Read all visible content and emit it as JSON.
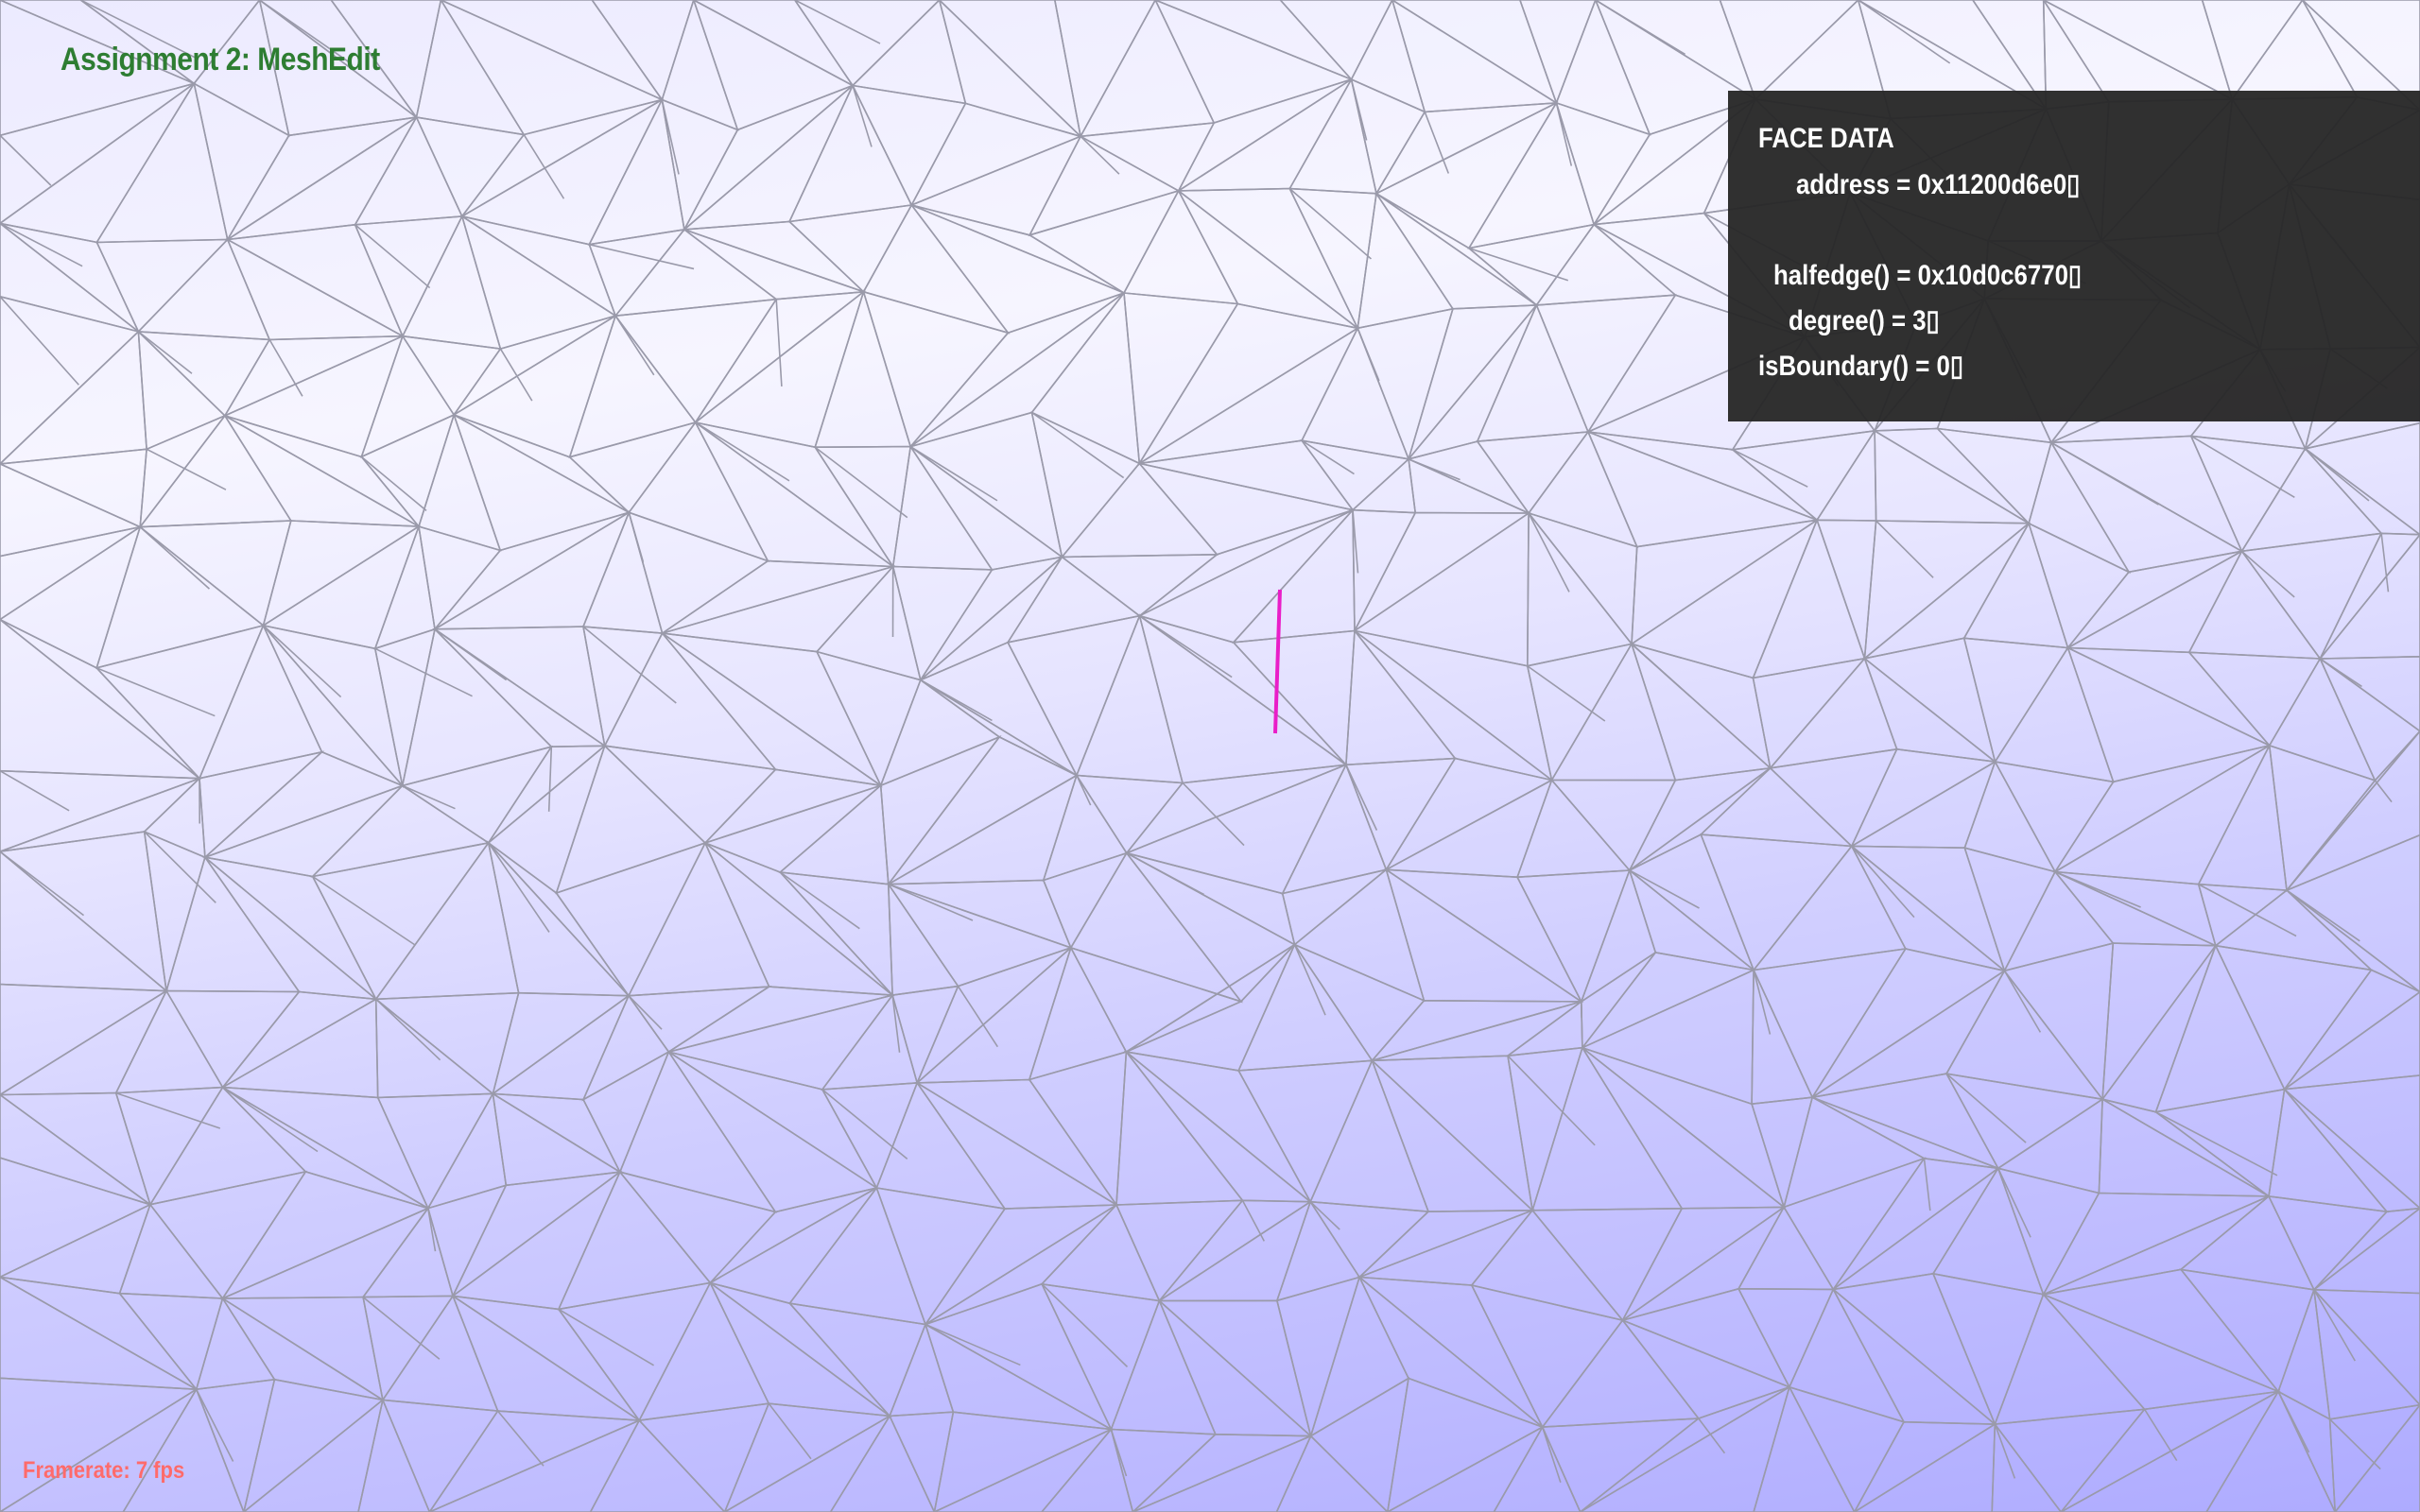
{
  "app": {
    "title": "Assignment 2: MeshEdit",
    "framerate": "Framerate: 7 fps"
  },
  "face_data": {
    "heading": "FACE DATA",
    "lines": [
      "address = 0x11200d6e0▯",
      "halfedge() = 0x10d0c6770▯",
      "degree() = 3▯",
      "isBoundary() = 0▯"
    ]
  },
  "colors": {
    "mesh_edge": "#9a9aaa",
    "selected_edge": "#e91ec8",
    "panel_background": "#282828",
    "title": "#2e7d32",
    "framerate": "#ff6b6b"
  }
}
